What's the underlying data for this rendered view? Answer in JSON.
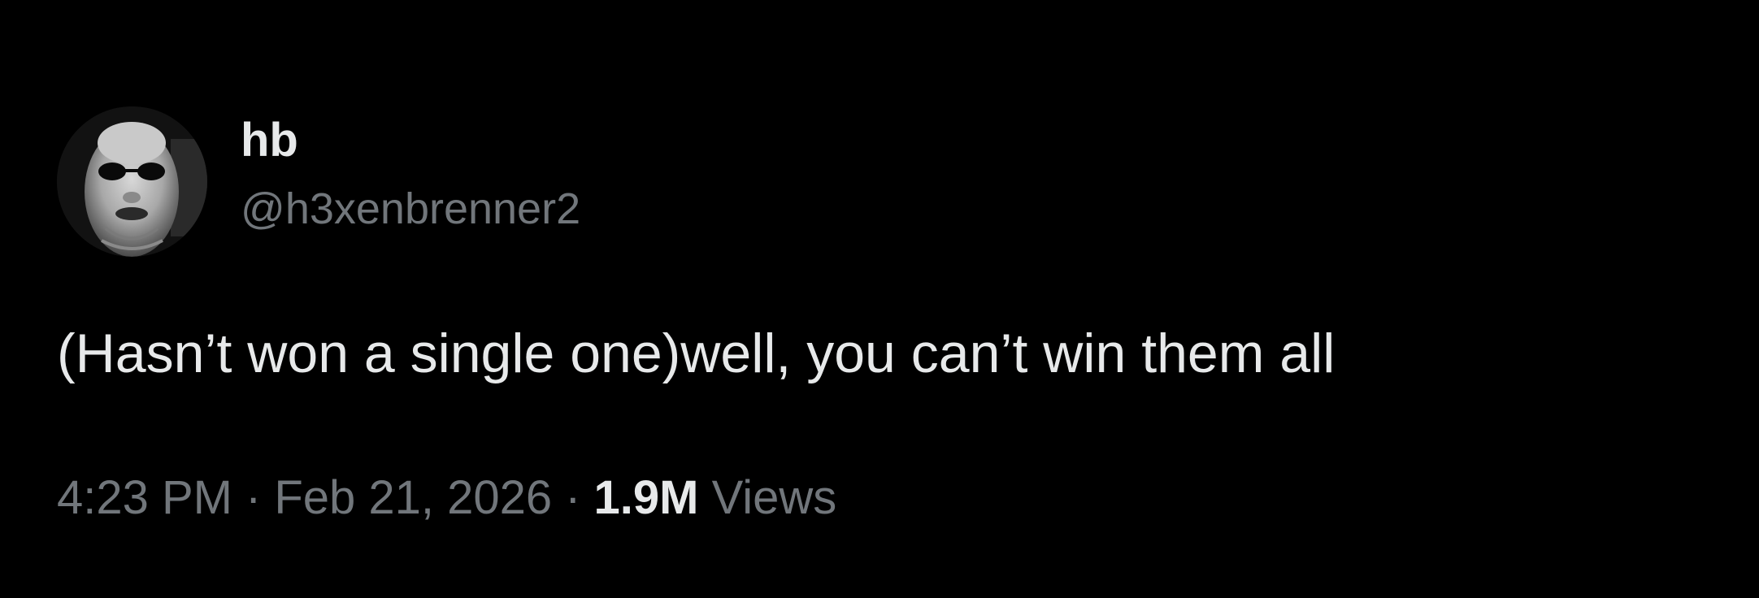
{
  "author": {
    "display_name": "hb",
    "handle": "@h3xenbrenner2",
    "avatar_icon": "user-avatar-icon"
  },
  "tweet": {
    "text": "(Hasn’t won a single one)well, you can’t win them all"
  },
  "meta": {
    "time": "4:23 PM",
    "separator": "·",
    "date": "Feb 21, 2026",
    "views_count": "1.9M",
    "views_label": "Views"
  },
  "colors": {
    "background": "#000000",
    "primary_text": "#e7e9ea",
    "secondary_text": "#71767b"
  }
}
